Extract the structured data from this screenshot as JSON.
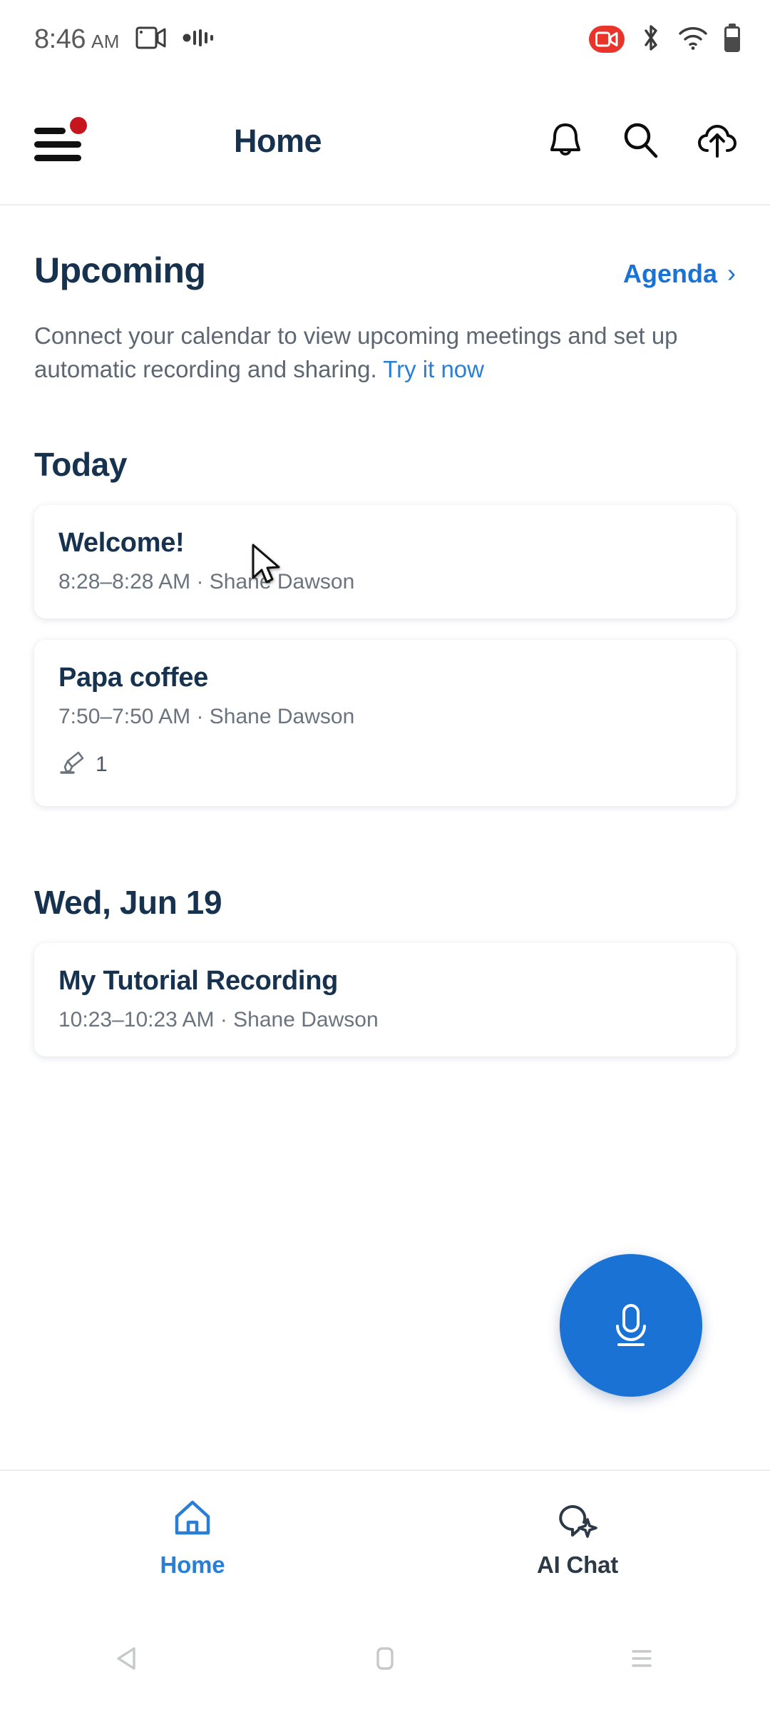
{
  "status_bar": {
    "time": "8:46",
    "ampm": "AM",
    "icons": [
      "screen-record-icon",
      "audio-waves-icon",
      "recording-badge-icon",
      "bluetooth-icon",
      "wifi-icon",
      "battery-icon"
    ]
  },
  "header": {
    "menu_icon": "hamburger-menu-icon",
    "has_notification_dot": true,
    "title": "Home",
    "icons": [
      "bell-icon",
      "search-icon",
      "cloud-upload-icon"
    ]
  },
  "upcoming": {
    "title": "Upcoming",
    "agenda_label": "Agenda",
    "agenda_chevron": "›",
    "description_part1": "Connect your calendar to view upcoming meetings and set up automatic recording and sharing. ",
    "description_link": "Try it now"
  },
  "sections": [
    {
      "heading": "Today",
      "cards": [
        {
          "title": "Welcome!",
          "subtitle": "8:28–8:28 AM ·  Shane Dawson",
          "meta_count": null
        },
        {
          "title": "Papa coffee",
          "subtitle": "7:50–7:50 AM ·  Shane Dawson",
          "meta_icon": "highlighter-icon",
          "meta_count": "1"
        }
      ]
    },
    {
      "heading": "Wed, Jun 19",
      "cards": [
        {
          "title": "My Tutorial Recording",
          "subtitle": "10:23–10:23 AM ·  Shane Dawson",
          "meta_count": null
        }
      ]
    }
  ],
  "fab": {
    "icon": "microphone-icon",
    "color": "#1a73d4"
  },
  "bottom_nav": {
    "items": [
      {
        "label": "Home",
        "icon": "home-icon",
        "active": true
      },
      {
        "label": "AI Chat",
        "icon": "ai-chat-bubble-icon",
        "active": false
      }
    ]
  },
  "system_nav": {
    "back": "back-triangle-icon",
    "home": "home-square-icon",
    "recents": "recents-lines-icon"
  },
  "colors": {
    "accent_blue": "#1a73d4",
    "link_blue": "#2a7fd4",
    "heading_navy": "#16324f",
    "body_gray": "#5d6671",
    "badge_red": "#c4161c",
    "record_red": "#e8342a"
  }
}
